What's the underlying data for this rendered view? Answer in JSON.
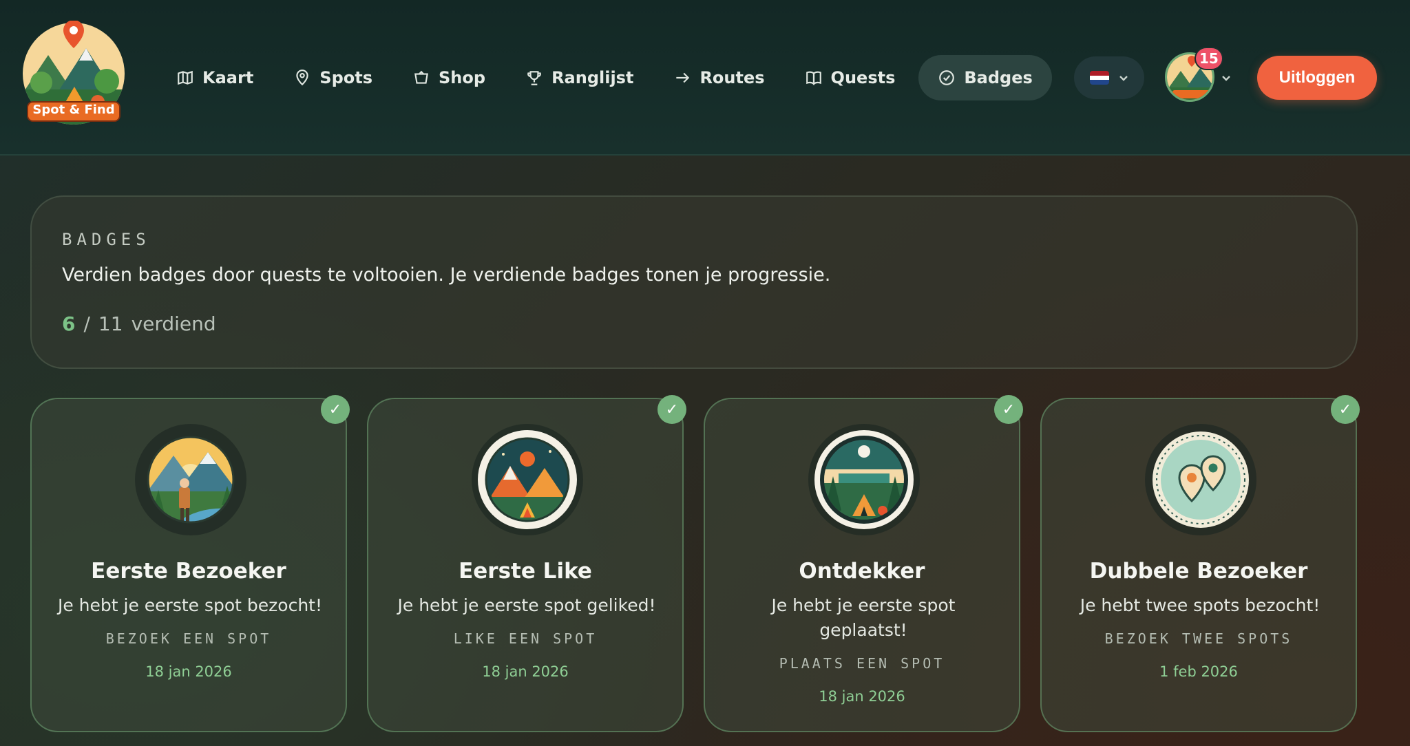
{
  "header": {
    "logo_text": "Spot & Find",
    "nav": [
      {
        "label": "Kaart",
        "icon": "map-icon"
      },
      {
        "label": "Spots",
        "icon": "pin-icon"
      },
      {
        "label": "Shop",
        "icon": "basket-icon"
      },
      {
        "label": "Ranglijst",
        "icon": "trophy-icon"
      },
      {
        "label": "Routes",
        "icon": "arrow-right-icon"
      },
      {
        "label": "Quests",
        "icon": "book-icon"
      },
      {
        "label": "Badges",
        "icon": "check-circle-icon",
        "active": true
      }
    ],
    "language": "nl",
    "notification_count": "15",
    "logout_label": "Uitloggen"
  },
  "intro": {
    "kicker": "BADGES",
    "description": "Verdien badges door quests te voltooien. Je verdiende badges tonen je progressie.",
    "earned": "6",
    "separator": "/",
    "total": "11",
    "suffix": "verdiend"
  },
  "badges": [
    {
      "title": "Eerste Bezoeker",
      "description": "Je hebt je eerste spot bezocht!",
      "requirement": "BEZOEK EEN SPOT",
      "date": "18 jan 2026"
    },
    {
      "title": "Eerste Like",
      "description": "Je hebt je eerste spot geliked!",
      "requirement": "LIKE EEN SPOT",
      "date": "18 jan 2026"
    },
    {
      "title": "Ontdekker",
      "description": "Je hebt je eerste spot geplaatst!",
      "requirement": "PLAATS EEN SPOT",
      "date": "18 jan 2026"
    },
    {
      "title": "Dubbele Bezoeker",
      "description": "Je hebt twee spots bezocht!",
      "requirement": "BEZOEK TWEE SPOTS",
      "date": "1 feb 2026"
    }
  ],
  "colors": {
    "accent_green": "#7cc287",
    "logout_orange": "#f0623f",
    "notif_red": "#ee5268"
  }
}
